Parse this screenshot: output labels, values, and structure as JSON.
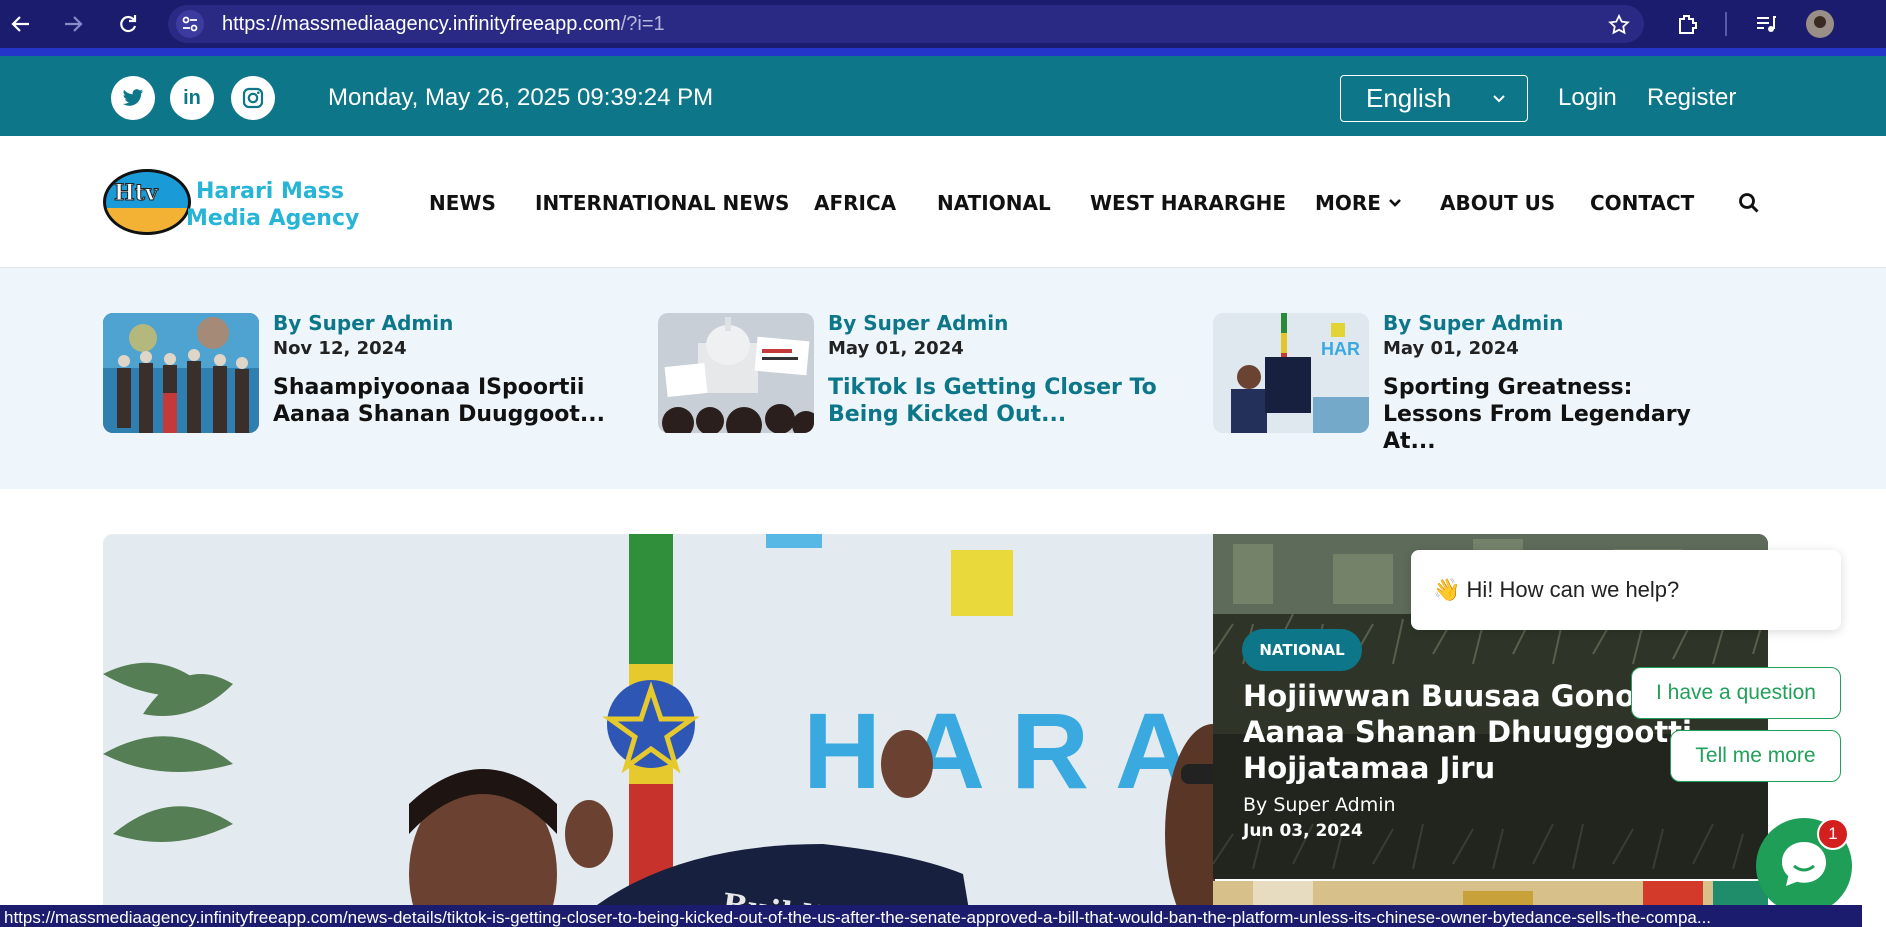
{
  "browser": {
    "url_host": "https://massmediaagency.infinityfreeapp.com",
    "url_path": "/?i=1",
    "status_url": "https://massmediaagency.infinityfreeapp.com/news-details/tiktok-is-getting-closer-to-being-kicked-out-of-the-us-after-the-senate-approved-a-bill-that-would-ban-the-platform-unless-its-chinese-owner-bytedance-sells-the-compa..."
  },
  "topbar": {
    "socials": [
      "twitter-icon",
      "linkedin-icon",
      "instagram-icon"
    ],
    "linkedin_label": "in",
    "datetime": "Monday, May 26, 2025 09:39:24 PM",
    "language": "English",
    "login": "Login",
    "register": "Register"
  },
  "header": {
    "logo_mark": "Htv",
    "logo_line1": "Harari Mass",
    "logo_line2": "Media Agency",
    "nav": [
      "NEWS",
      "INTERNATIONAL NEWS",
      "AFRICA",
      "NATIONAL",
      "WEST HARARGHE",
      "MORE",
      "ABOUT US",
      "CONTACT"
    ]
  },
  "featured": [
    {
      "by": "By Super Admin",
      "date": "Nov 12, 2024",
      "title": "Shaampiyoonaa ISpoortii Aanaa Shanan Duuggoot..."
    },
    {
      "by": "By Super Admin",
      "date": "May 01, 2024",
      "title": "TikTok Is Getting Closer To Being Kicked Out..."
    },
    {
      "by": "By Super Admin",
      "date": "May 01, 2024",
      "title": "Sporting Greatness: Lessons From Legendary At..."
    }
  ],
  "hero": {
    "sign_text": "HARA",
    "shirt_text": "Building",
    "side": {
      "category": "NATIONAL",
      "title": "Hojiiwwan Buusaa Gonofaa Akka Aanaa Shanan Dhuuggootti Hojjatamaa Jiru",
      "by": "By Super Admin",
      "date": "Jun 03, 2024"
    }
  },
  "chat": {
    "greeting": "👋 Hi! How can we help?",
    "options": [
      "I have a question",
      "Tell me more"
    ],
    "unread": "1"
  },
  "colors": {
    "brand_teal": "#0d7789",
    "logo_cyan": "#26b5d6",
    "chat_green": "#1e9e57",
    "browser_navy": "#1c1c6e"
  }
}
